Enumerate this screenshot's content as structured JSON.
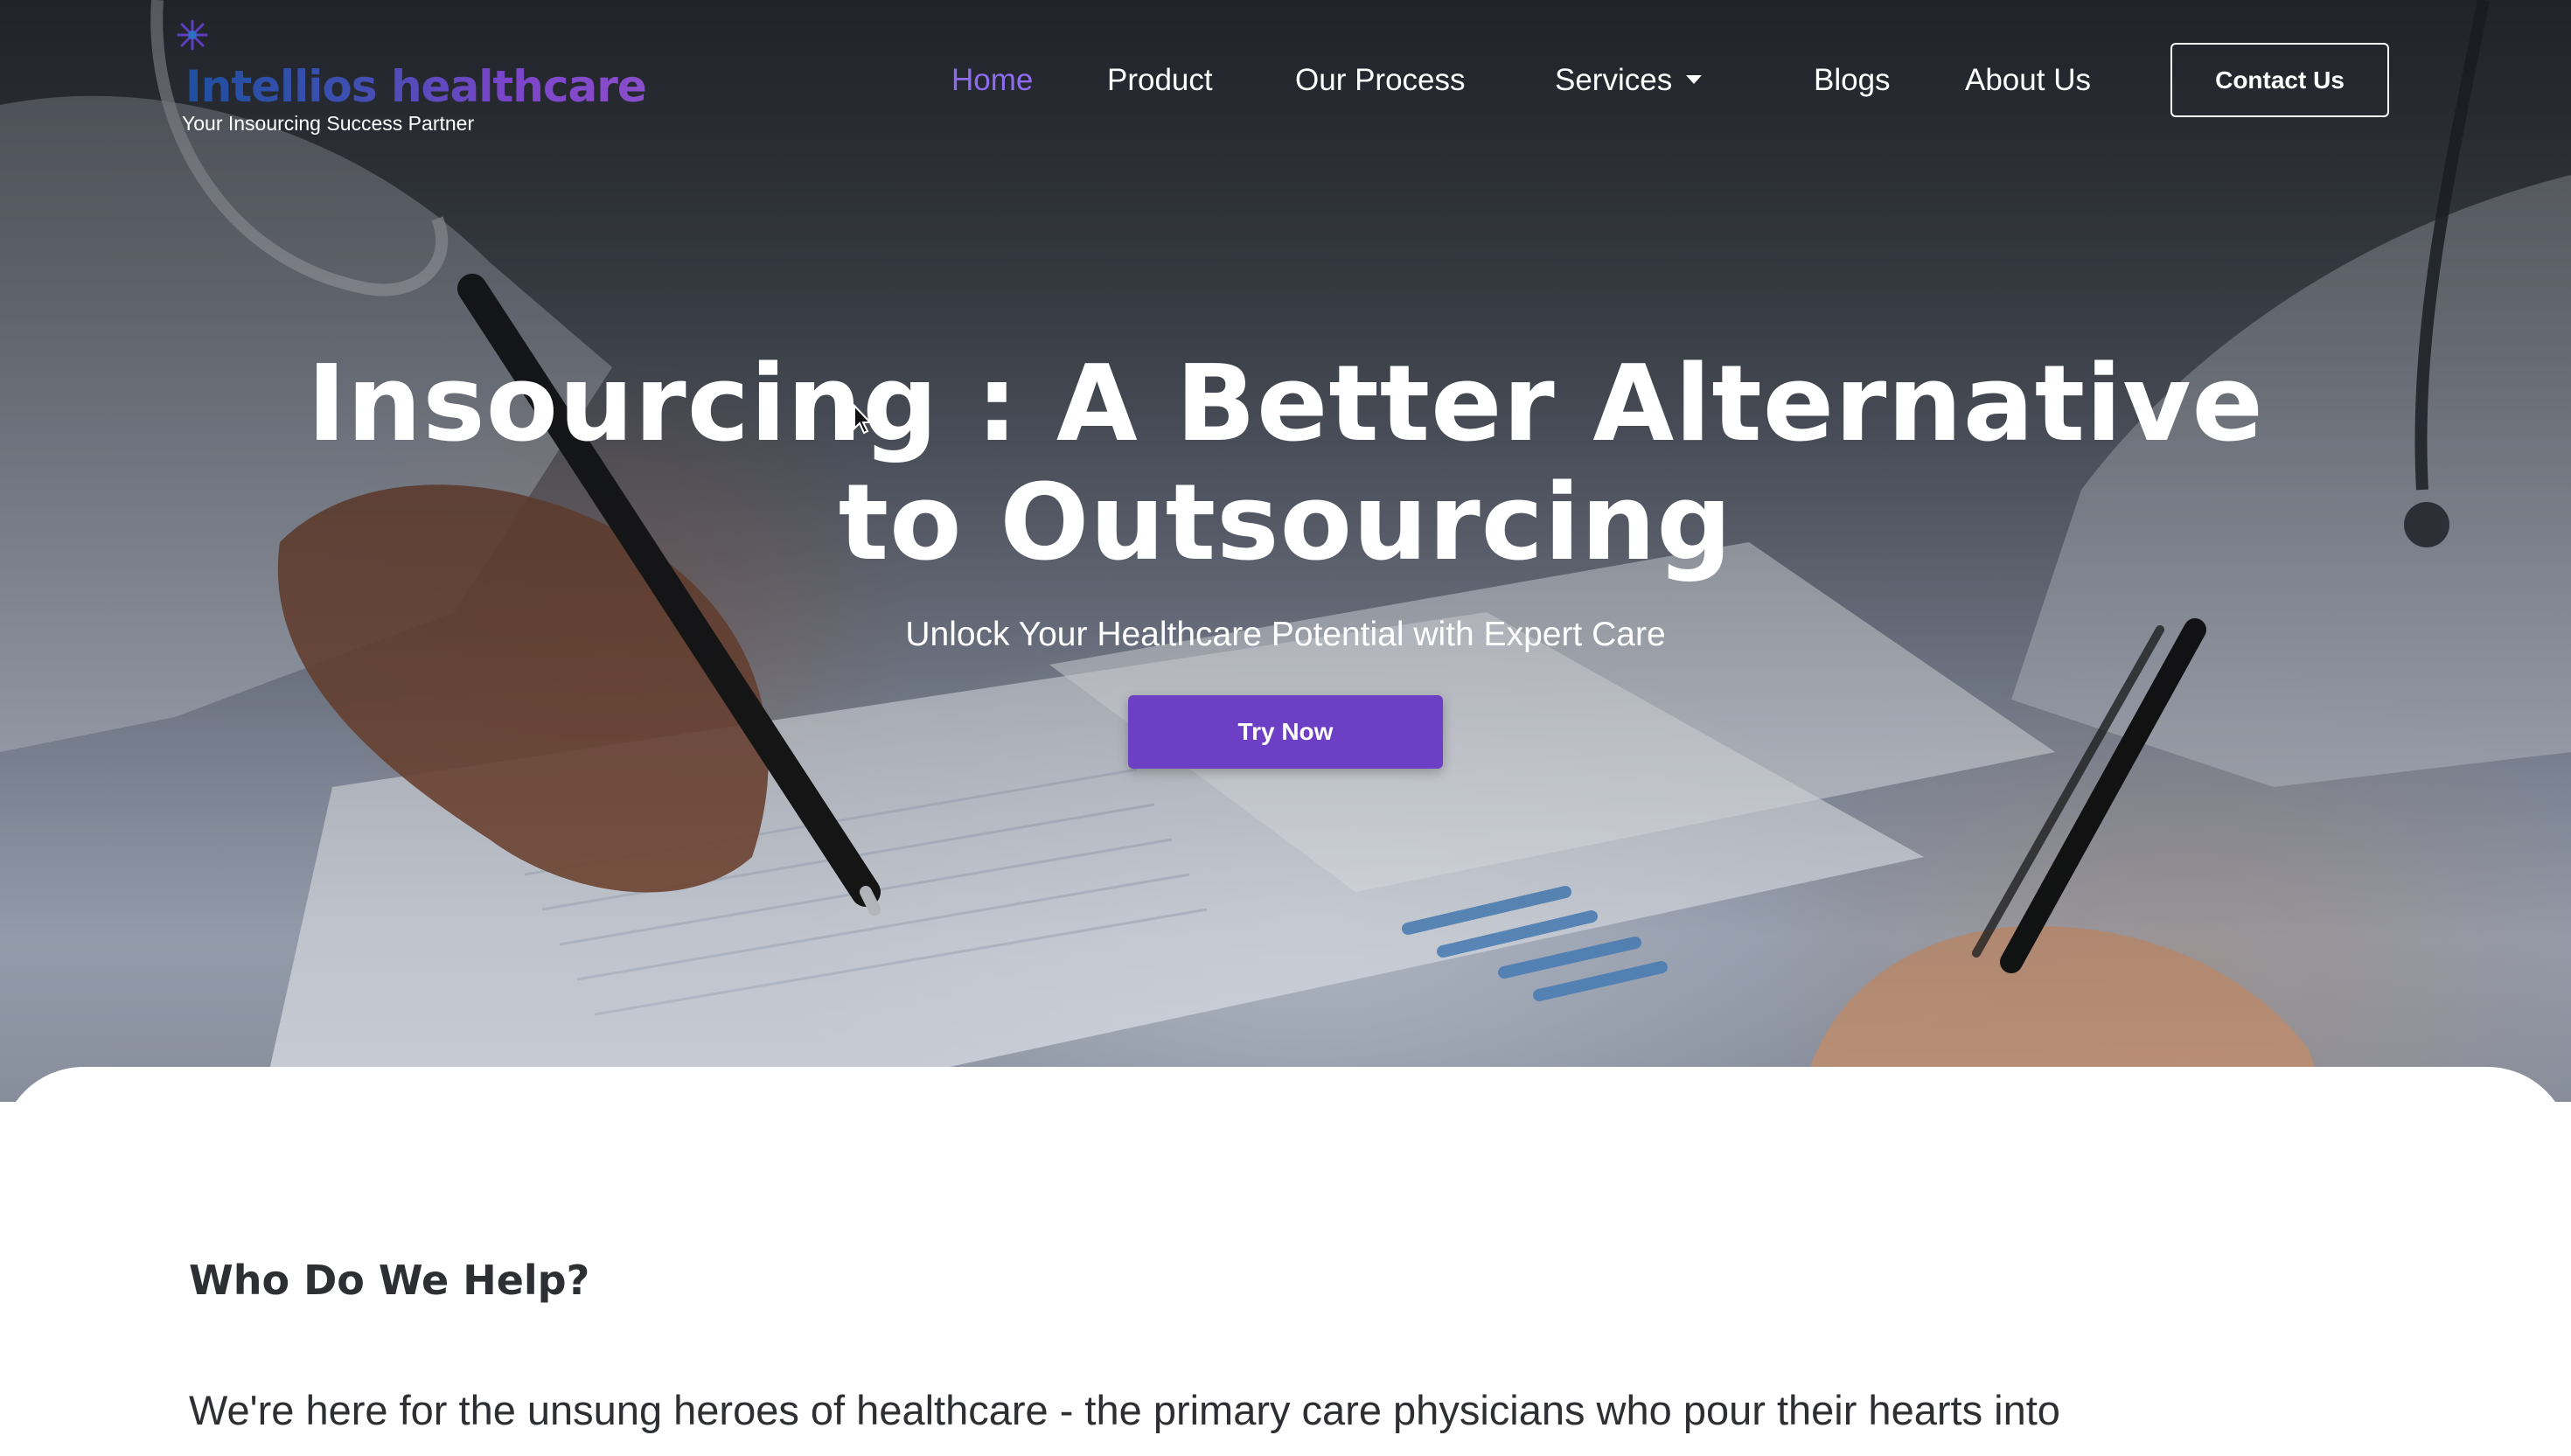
{
  "brand": {
    "name": "Intellios healthcare",
    "tagline": "Your Insourcing Success Partner",
    "gradient_colors": [
      "#1f4fa0",
      "#8a4ecb"
    ]
  },
  "nav": {
    "items": [
      {
        "label": "Home",
        "active": true
      },
      {
        "label": "Product",
        "active": false
      },
      {
        "label": "Our Process",
        "active": false
      },
      {
        "label": "Services",
        "active": false,
        "has_dropdown": true
      },
      {
        "label": "Blogs",
        "active": false
      },
      {
        "label": "About Us",
        "active": false
      }
    ],
    "active_color": "#8e6cf0",
    "dropdown_icon": "caret-down-icon",
    "contact_label": "Contact Us"
  },
  "hero": {
    "headline_strong": "Insourcing",
    "headline_rest": " : A Better Alternative to Outsourcing",
    "subheadline": "Unlock Your Healthcare Potential with Expert Care",
    "cta_label": "Try Now",
    "cta_color": "#6c3fc4"
  },
  "section": {
    "title": "Who Do We Help?",
    "body": "We're here for the unsung heroes of healthcare - the primary care physicians who pour their hearts into"
  }
}
